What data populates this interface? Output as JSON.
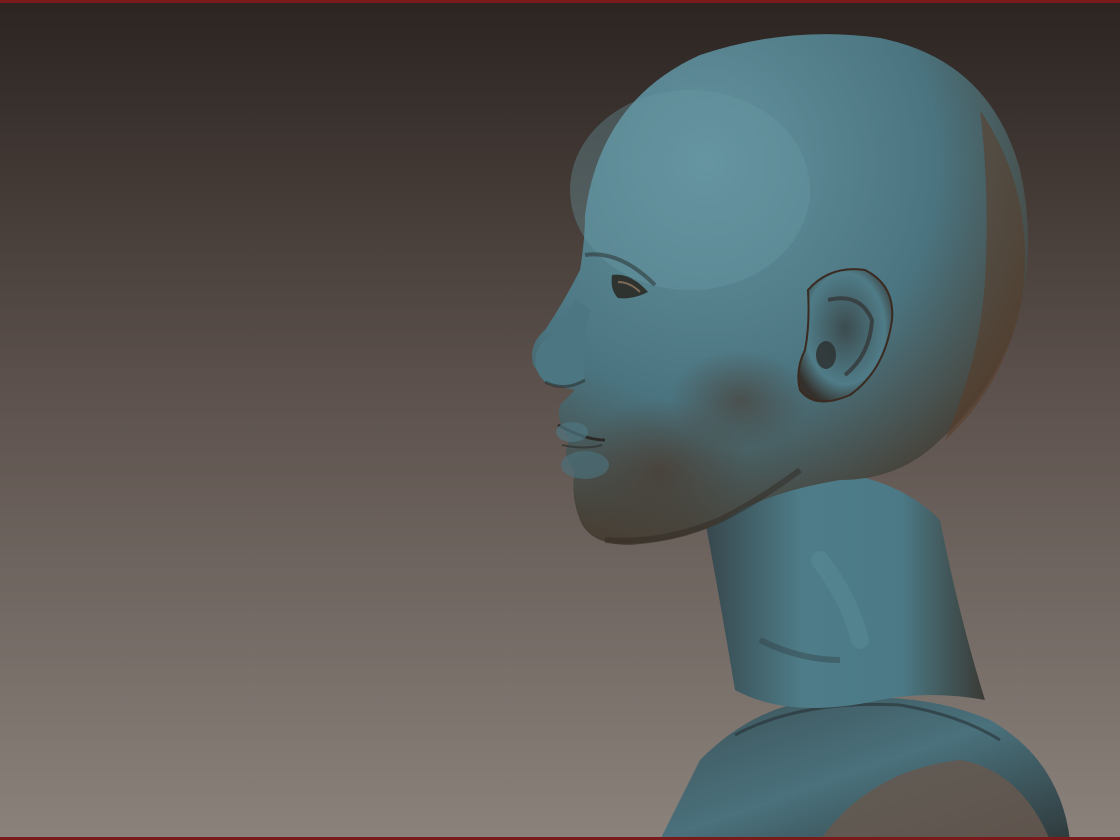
{
  "scene": {
    "subject": "sculpted-head-profile",
    "background_top_color": "#2b2421",
    "background_bottom_color": "#8b827c",
    "frame_color": "#7a1a1a",
    "skin_highlight_color": "#5b8a98",
    "skin_mid_color": "#436b76",
    "skin_shadow_color": "#3a2e26"
  }
}
